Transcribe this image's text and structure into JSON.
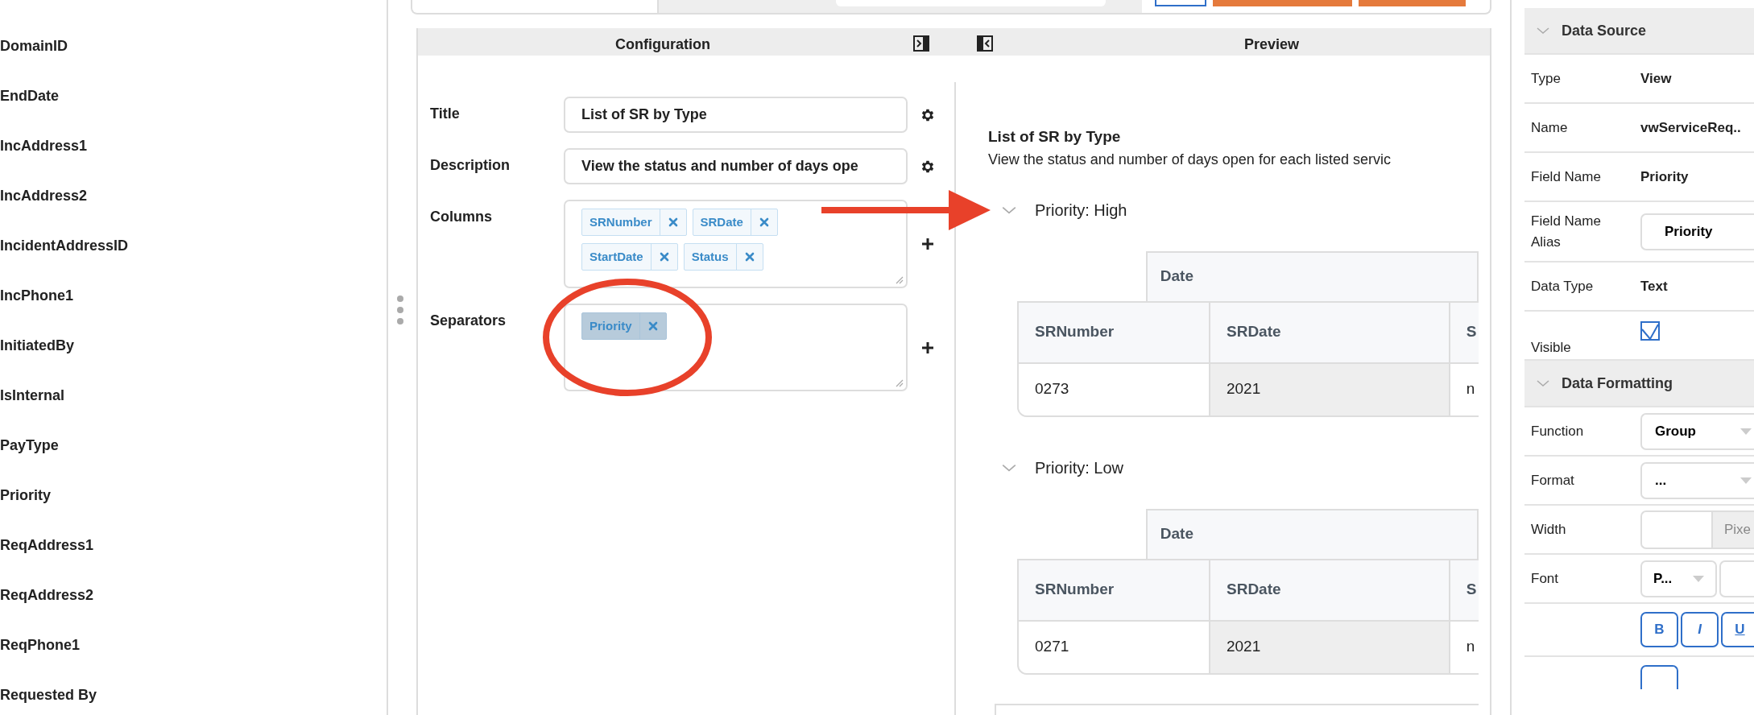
{
  "field_list": [
    "DomainID",
    "EndDate",
    "IncAddress1",
    "IncAddress2",
    "IncidentAddressID",
    "IncPhone1",
    "InitiatedBy",
    "IsInternal",
    "PayType",
    "Priority",
    "ReqAddress1",
    "ReqAddress2",
    "ReqPhone1",
    "Requested By"
  ],
  "configuration": {
    "header": "Configuration",
    "fields": [
      {
        "kind": "input",
        "label": "Title",
        "value": "List of SR by Type"
      },
      {
        "kind": "input",
        "label": "Description",
        "value": "View the status and number of days ope"
      },
      {
        "kind": "tags",
        "label": "Columns",
        "tags": [
          {
            "label": "SRNumber",
            "selected": false
          },
          {
            "label": "SRDate",
            "selected": false
          },
          {
            "label": "StartDate",
            "selected": false
          },
          {
            "label": "Status",
            "selected": false
          }
        ]
      },
      {
        "kind": "tags",
        "label": "Separators",
        "tags": [
          {
            "label": "Priority",
            "selected": true
          }
        ]
      }
    ]
  },
  "preview": {
    "header": "Preview",
    "title": "List of SR by Type",
    "description": "View the status and number of days open for each listed servic",
    "groups": [
      {
        "label": "Priority: High",
        "expanded": true,
        "group_header": "Date",
        "columns": [
          "SRNumber",
          "SRDate",
          "S"
        ],
        "rows": [
          [
            "0273",
            "2021",
            "n"
          ]
        ]
      },
      {
        "label": "Priority: Low",
        "expanded": true,
        "group_header": "Date",
        "columns": [
          "SRNumber",
          "SRDate",
          "S"
        ],
        "rows": [
          [
            "0271",
            "2021",
            "n"
          ]
        ]
      }
    ]
  },
  "properties": [
    {
      "title": "Data Source",
      "expanded": true,
      "rows": [
        {
          "kind": "text",
          "label": "Type",
          "value": "View"
        },
        {
          "kind": "text",
          "label": "Name",
          "value": "vwServiceReq.."
        },
        {
          "kind": "text",
          "label": "Field Name",
          "value": "Priority"
        },
        {
          "kind": "input",
          "label": "Field Name Alias",
          "value": "Priority"
        },
        {
          "kind": "text",
          "label": "Data Type",
          "value": "Text"
        },
        {
          "kind": "checkbox",
          "label": "Visible",
          "checked": true
        }
      ]
    },
    {
      "title": "Data Formatting",
      "expanded": true,
      "rows": [
        {
          "kind": "select",
          "label": "Function",
          "value": "Group"
        },
        {
          "kind": "select",
          "label": "Format",
          "value": "..."
        },
        {
          "kind": "unit_input",
          "label": "Width",
          "unit": "Pixe"
        },
        {
          "kind": "font",
          "label": "Font",
          "value": "P..."
        },
        {
          "kind": "style_buttons",
          "buttons": [
            {
              "label": "B",
              "selected": false
            },
            {
              "label": "I",
              "selected": false
            },
            {
              "label": "U",
              "selected": false
            }
          ]
        }
      ]
    }
  ]
}
